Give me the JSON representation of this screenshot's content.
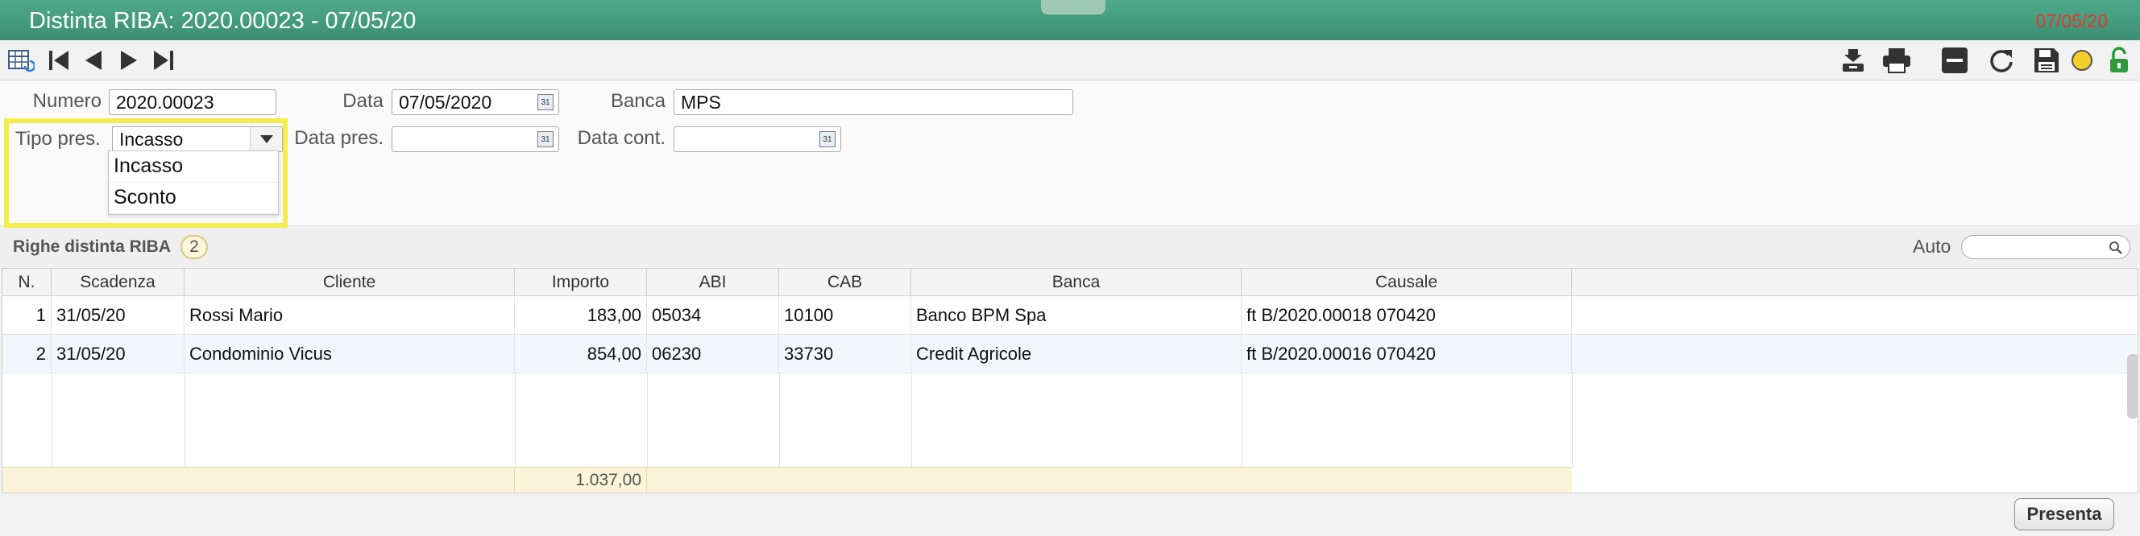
{
  "window": {
    "title": "Distinta RIBA: 2020.00023 - 07/05/20",
    "date": "07/05/20"
  },
  "toolbar": {
    "left_icons": [
      "grid-refresh-icon",
      "first-record-icon",
      "previous-record-icon",
      "next-record-icon",
      "last-record-icon"
    ],
    "right_icons": [
      "archive-download-icon",
      "print-icon",
      "minimize-icon",
      "refresh-icon",
      "save-icon",
      "status-dot-icon",
      "unlock-icon"
    ]
  },
  "form": {
    "numero_label": "Numero",
    "numero_value": "2020.00023",
    "data_label": "Data",
    "data_value": "07/05/2020",
    "banca_label": "Banca",
    "banca_value": "MPS",
    "tipo_label": "Tipo pres.",
    "tipo_value": "Incasso",
    "data_pres_label": "Data pres.",
    "data_pres_value": "",
    "data_cont_label": "Data cont.",
    "data_cont_value": "",
    "tipo_options": [
      "Incasso",
      "Sconto"
    ]
  },
  "section": {
    "title": "Righe distinta RIBA",
    "count": "2",
    "auto_label": "Auto"
  },
  "table": {
    "columns": [
      "N.",
      "Scadenza",
      "Cliente",
      "Importo",
      "ABI",
      "CAB",
      "Banca",
      "Causale"
    ],
    "rows": [
      [
        "1",
        "31/05/20",
        "Rossi Mario",
        "183,00",
        "05034",
        "10100",
        "Banco BPM Spa",
        "ft B/2020.00018 070420"
      ],
      [
        "2",
        "31/05/20",
        "Condominio Vicus",
        "854,00",
        "06230",
        "33730",
        "Credit Agricole",
        "ft B/2020.00016 070420"
      ]
    ],
    "total": "1.037,00"
  },
  "footer": {
    "presenta_label": "Presenta"
  },
  "colors": {
    "titlebar": "#3b8f72",
    "date_red": "#e03a2e",
    "highlight": "#f4ee4c"
  }
}
